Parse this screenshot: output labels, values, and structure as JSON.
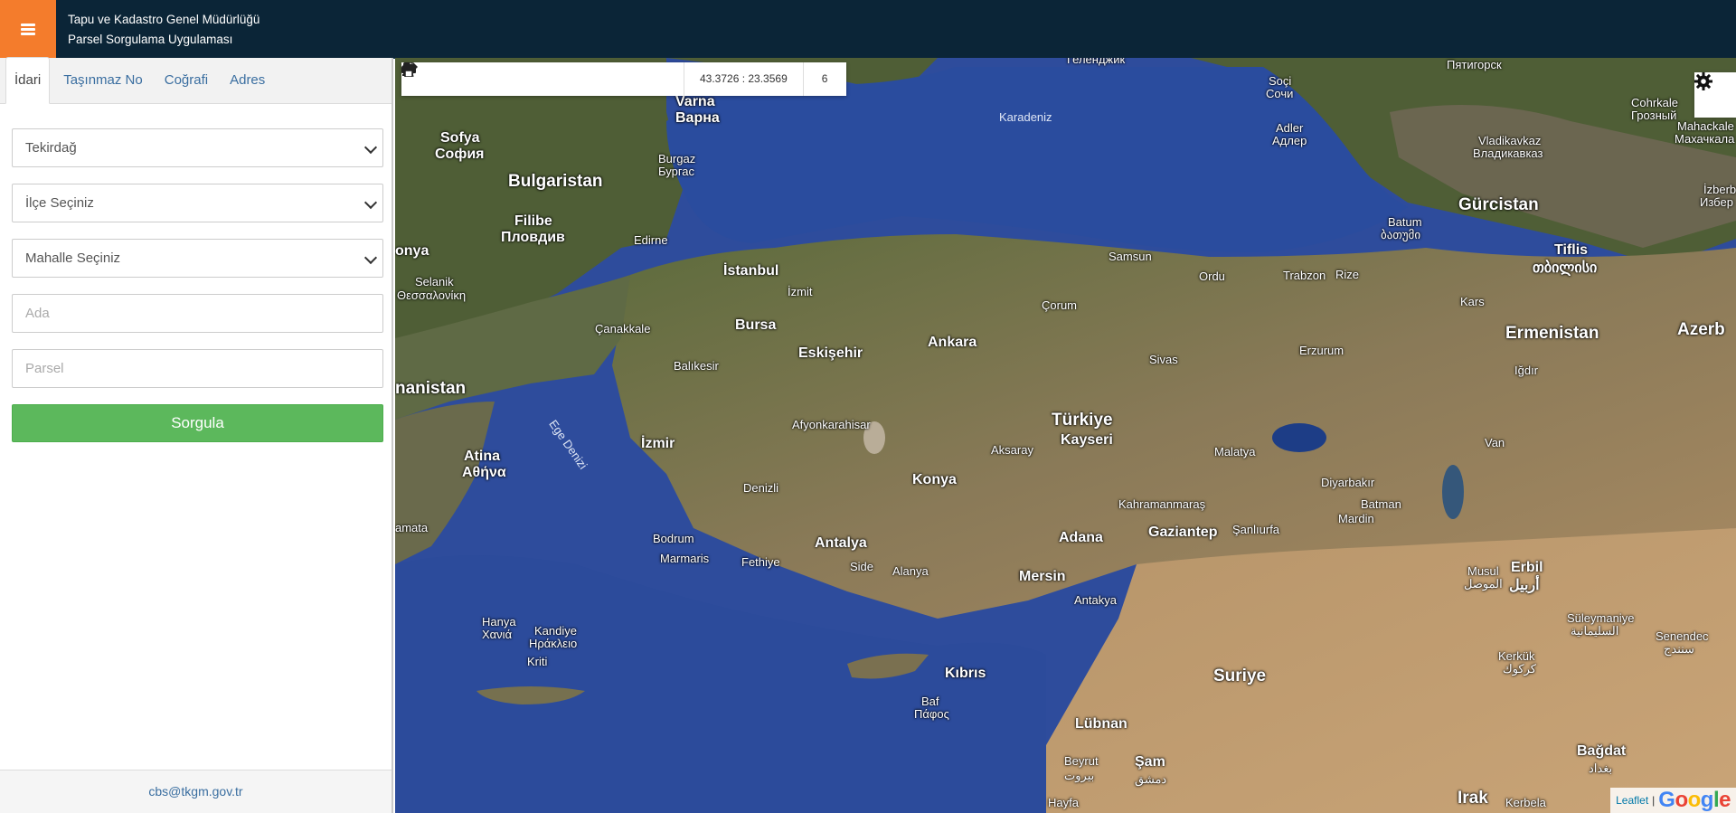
{
  "header": {
    "title_line1": "Tapu ve Kadastro Genel Müdürlüğü",
    "title_line2": "Parsel Sorgulama Uygulaması",
    "menu_icon": "hamburger-icon",
    "accent_color": "#f47c2c",
    "bg_color": "#0b2537"
  },
  "sidebar": {
    "tabs": [
      {
        "label": "İdari",
        "active": true
      },
      {
        "label": "Taşınmaz No",
        "active": false
      },
      {
        "label": "Coğrafi",
        "active": false
      },
      {
        "label": "Adres",
        "active": false
      }
    ],
    "form": {
      "il_value": "Tekirdağ",
      "ilce_value": "İlçe Seçiniz",
      "mahalle_value": "Mahalle Seçiniz",
      "ada_placeholder": "Ada",
      "parsel_placeholder": "Parsel",
      "submit_label": "Sorgula"
    },
    "footer_email": "cbs@tkgm.gov.tr"
  },
  "map": {
    "toolbar": {
      "buttons": [
        "plus-icon",
        "minus-icon",
        "refresh-icon",
        "crosshair-icon",
        "info-icon",
        "star-icon",
        "measure-icon",
        "print-icon"
      ],
      "coordinates": "43.3726 : 23.3569",
      "zoom": "6"
    },
    "settings_icon": "gear-icon",
    "attribution": {
      "leaflet": "Leaflet",
      "separator": "|",
      "google": "Google"
    },
    "labels": {
      "karadeniz": "Karadeniz",
      "varna": "Varna",
      "varna_cyr": "Варна",
      "sofya": "Sofya",
      "sofya_cyr": "София",
      "bulgaristan": "Bulgaristan",
      "burgaz": "Burgaz",
      "burgaz_cyr": "Бургас",
      "filibe": "Filibe",
      "plovdiv": "Пловдив",
      "edirne": "Edirne",
      "selanik": "Selanik",
      "selanik_gr": "Θεσσαλονίκη",
      "istanbul": "İstanbul",
      "izmit": "İzmit",
      "bursa": "Bursa",
      "canakkale": "Çanakkale",
      "balikesir": "Balıkesir",
      "eskisehir": "Eskişehir",
      "ankara": "Ankara",
      "samsun": "Samsun",
      "ordu": "Ordu",
      "trabzon": "Trabzon",
      "rize": "Rize",
      "batum": "Batum",
      "batum_ge": "ბათუმი",
      "gurcistan": "Gürcistan",
      "tiflis": "Tiflis",
      "tiflis_ge": "თბილისი",
      "soci": "Soçi",
      "soci_cyr": "Сочи",
      "adler": "Adler",
      "adler_cyr": "Адлер",
      "pyatigorsk": "Пятигорск",
      "gelendzhik": "Геленджик",
      "cohrkale": "Cohrkale",
      "cohrkale_cyr": "Грозный",
      "vladikavkaz": "Vladikavkaz",
      "vladikavkaz_cyr": "Владикавказ",
      "mahackale": "Mahackale",
      "mahackale_cyr": "Махачкала",
      "izberb": "İzberb",
      "izberb_cyr": "Избер",
      "kars": "Kars",
      "ermenistan": "Ermenistan",
      "azerb": "Azerb",
      "igdir": "Iğdır",
      "corum": "Çorum",
      "sivas": "Sivas",
      "erzurum": "Erzurum",
      "turkiye": "Türkiye",
      "kayseri": "Kayseri",
      "aksaray": "Aksaray",
      "afyon": "Afyonkarahisar",
      "izmir": "İzmir",
      "atina": "Atina",
      "atina_gr": "Αθήνα",
      "yunanistan": "nanistan",
      "onya": "onya",
      "ege_denizi": "Ege Denizi",
      "konya": "Konya",
      "malatya": "Malatya",
      "van": "Van",
      "diyarbakir": "Diyarbakır",
      "batman": "Batman",
      "mardin": "Mardin",
      "kahramanmaras": "Kahramanmaraş",
      "gaziantep": "Gaziantep",
      "sanliurfa": "Şanlıurfa",
      "denizli": "Denizli",
      "bodrum": "Bodrum",
      "marmaris": "Marmaris",
      "fethiye": "Fethiye",
      "antalya": "Antalya",
      "side": "Side",
      "alanya": "Alanya",
      "adana": "Adana",
      "mersin": "Mersin",
      "antakya": "Antakya",
      "musul": "Musul",
      "musul_ar": "الموصل",
      "erbil": "Erbil",
      "erbil_ar": "أربيل",
      "suleymaniye": "Süleymaniye",
      "suleymaniye_ar": "السليمانية",
      "senendec": "Senendec",
      "senendec_ar": "سنندج",
      "kerkuk": "Kerkük",
      "kerkuk_ar": "كركوك",
      "amata": "amata",
      "hanya": "Hanya",
      "hanya_gr": "Χανιά",
      "kandiye": "Kandiye",
      "kandiye_gr": "Ηράκλειο",
      "kriti": "Kriti",
      "kibris": "Kıbrıs",
      "baf": "Baf",
      "baf_gr": "Πάφος",
      "suriye": "Suriye",
      "lubnan": "Lübnan",
      "beyrut": "Beyrut",
      "beyrut_ar": "بيروت",
      "sam": "Şam",
      "sam_ar": "دمشق",
      "hayfa": "Hayfa",
      "irak": "Irak",
      "kerbela": "Kerbela",
      "bagdat": "Bağdat",
      "bagdat_ar": "بغداد"
    }
  }
}
